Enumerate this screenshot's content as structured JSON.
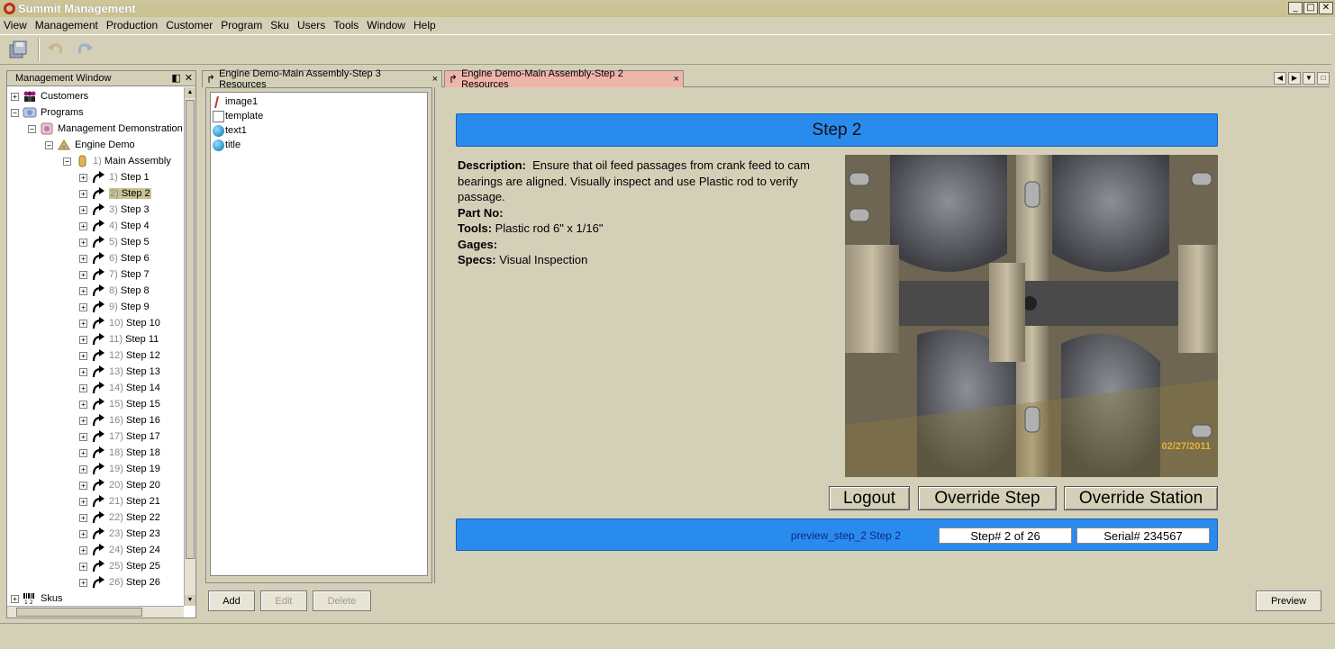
{
  "window": {
    "title": "Summit Management"
  },
  "menu": [
    "View",
    "Management",
    "Production",
    "Customer",
    "Program",
    "Sku",
    "Users",
    "Tools",
    "Window",
    "Help"
  ],
  "mgmt": {
    "title": "Management Window",
    "tree": {
      "customers": "Customers",
      "programs": "Programs",
      "management_demo": "Management Demonstration",
      "engine_demo": "Engine Demo",
      "main_assembly_num": "1)",
      "main_assembly": "Main Assembly",
      "steps": [
        {
          "num": "1)",
          "label": "Step 1"
        },
        {
          "num": "2)",
          "label": "Step 2"
        },
        {
          "num": "3)",
          "label": "Step 3"
        },
        {
          "num": "4)",
          "label": "Step 4"
        },
        {
          "num": "5)",
          "label": "Step 5"
        },
        {
          "num": "6)",
          "label": "Step 6"
        },
        {
          "num": "7)",
          "label": "Step 7"
        },
        {
          "num": "8)",
          "label": "Step 8"
        },
        {
          "num": "9)",
          "label": "Step 9"
        },
        {
          "num": "10)",
          "label": "Step 10"
        },
        {
          "num": "11)",
          "label": "Step 11"
        },
        {
          "num": "12)",
          "label": "Step 12"
        },
        {
          "num": "13)",
          "label": "Step 13"
        },
        {
          "num": "14)",
          "label": "Step 14"
        },
        {
          "num": "15)",
          "label": "Step 15"
        },
        {
          "num": "16)",
          "label": "Step 16"
        },
        {
          "num": "17)",
          "label": "Step 17"
        },
        {
          "num": "18)",
          "label": "Step 18"
        },
        {
          "num": "19)",
          "label": "Step 19"
        },
        {
          "num": "20)",
          "label": "Step 20"
        },
        {
          "num": "21)",
          "label": "Step 21"
        },
        {
          "num": "22)",
          "label": "Step 22"
        },
        {
          "num": "23)",
          "label": "Step 23"
        },
        {
          "num": "24)",
          "label": "Step 24"
        },
        {
          "num": "25)",
          "label": "Step 25"
        },
        {
          "num": "26)",
          "label": "Step 26"
        }
      ],
      "skus": "Skus"
    }
  },
  "tabs": [
    {
      "label": "Engine Demo-Main Assembly-Step 3 Resources",
      "close": "×"
    },
    {
      "label": "Engine Demo-Main Assembly-Step 2 Resources",
      "close": "×"
    }
  ],
  "resources": [
    "image1",
    "template",
    "text1",
    "title"
  ],
  "res_buttons": {
    "add": "Add",
    "edit": "Edit",
    "delete": "Delete"
  },
  "step": {
    "title": "Step 2",
    "description_label": "Description:",
    "description": "Ensure that oil feed passages from crank feed to cam bearings are aligned. Visually inspect and use Plastic rod to verify passage.",
    "part_label": "Part No:",
    "tools_label": "Tools:",
    "tools": "Plastic rod 6\" x 1/16\"",
    "gages_label": "Gages:",
    "specs_label": "Specs:",
    "specs": "Visual Inspection",
    "photo_date": "02/27/2011",
    "buttons": {
      "logout": "Logout",
      "override_step": "Override Step",
      "override_station": "Override Station"
    },
    "status": {
      "preview": "preview_step_2 Step 2",
      "step_num": "Step# 2 of 26",
      "serial": "Serial# 234567"
    }
  },
  "preview_button": "Preview",
  "colors": {
    "banner": "#2a8bef",
    "chrome": "#d4d0b8",
    "active_tab": "#f0b5a9"
  }
}
